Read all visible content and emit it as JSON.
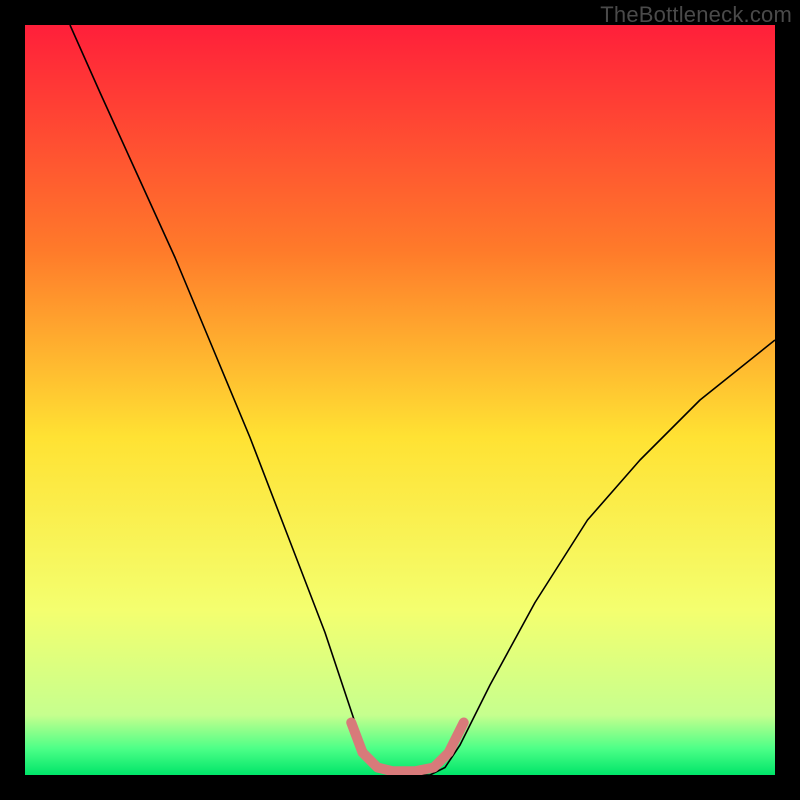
{
  "watermark": "TheBottleneck.com",
  "chart_data": {
    "type": "line",
    "title": "",
    "xlabel": "",
    "ylabel": "",
    "xlim": [
      0,
      100
    ],
    "ylim": [
      0,
      100
    ],
    "gradient_stops": [
      {
        "offset": 0,
        "color": "#ff1f3a"
      },
      {
        "offset": 0.3,
        "color": "#ff7a2a"
      },
      {
        "offset": 0.55,
        "color": "#ffe233"
      },
      {
        "offset": 0.78,
        "color": "#f4ff6f"
      },
      {
        "offset": 0.92,
        "color": "#c6ff8e"
      },
      {
        "offset": 0.965,
        "color": "#4cff87"
      },
      {
        "offset": 1,
        "color": "#00e569"
      }
    ],
    "series": [
      {
        "name": "bottleneck-curve",
        "color": "#000000",
        "width": 1.6,
        "points": [
          {
            "x": 6,
            "y": 100
          },
          {
            "x": 10,
            "y": 91
          },
          {
            "x": 15,
            "y": 80
          },
          {
            "x": 20,
            "y": 69
          },
          {
            "x": 25,
            "y": 57
          },
          {
            "x": 30,
            "y": 45
          },
          {
            "x": 35,
            "y": 32
          },
          {
            "x": 40,
            "y": 19
          },
          {
            "x": 43,
            "y": 10
          },
          {
            "x": 45,
            "y": 4
          },
          {
            "x": 47,
            "y": 1
          },
          {
            "x": 49,
            "y": 0
          },
          {
            "x": 51,
            "y": 0
          },
          {
            "x": 54,
            "y": 0
          },
          {
            "x": 56,
            "y": 1
          },
          {
            "x": 58,
            "y": 4
          },
          {
            "x": 62,
            "y": 12
          },
          {
            "x": 68,
            "y": 23
          },
          {
            "x": 75,
            "y": 34
          },
          {
            "x": 82,
            "y": 42
          },
          {
            "x": 90,
            "y": 50
          },
          {
            "x": 100,
            "y": 58
          }
        ]
      },
      {
        "name": "optimal-zone-highlight",
        "color": "#d87a7a",
        "width": 10,
        "cap": "round",
        "points": [
          {
            "x": 43.5,
            "y": 7
          },
          {
            "x": 45,
            "y": 3
          },
          {
            "x": 47,
            "y": 1
          },
          {
            "x": 49,
            "y": 0.5
          },
          {
            "x": 52,
            "y": 0.5
          },
          {
            "x": 54.5,
            "y": 1
          },
          {
            "x": 56.5,
            "y": 3
          },
          {
            "x": 58.5,
            "y": 7
          }
        ]
      }
    ]
  }
}
